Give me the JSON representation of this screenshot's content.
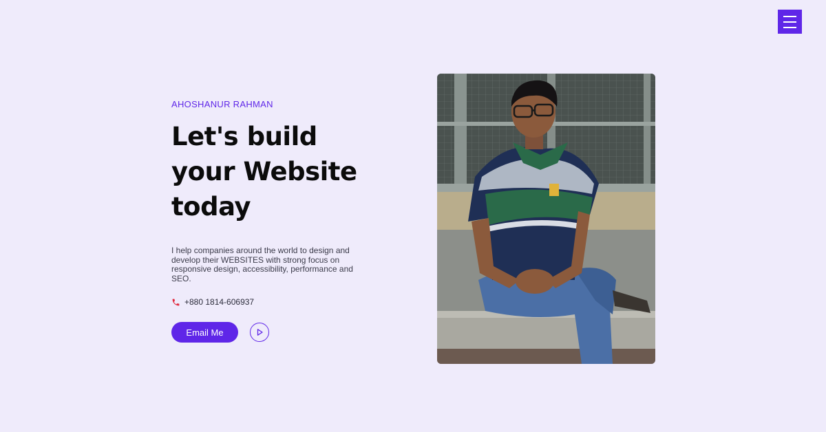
{
  "header": {
    "menu_icon": "hamburger-menu-icon"
  },
  "hero": {
    "name": "AHOSHANUR RAHMAN",
    "headline_lines": [
      "Let's build",
      "your Website",
      "today"
    ],
    "description": "I help companies around the world to design and develop their WEBSITES with strong focus on responsive design, accessibility, performance and SEO.",
    "phone": "+880 1814-606937",
    "phone_icon": "phone-icon",
    "email_button": "Email Me",
    "play_icon": "play-circle-icon"
  },
  "photo": {
    "icon": "portrait-photo"
  },
  "colors": {
    "background": "#efebfb",
    "accent": "#5f26e8",
    "heading": "#0b0b0b",
    "phone_icon": "#e0283c"
  }
}
